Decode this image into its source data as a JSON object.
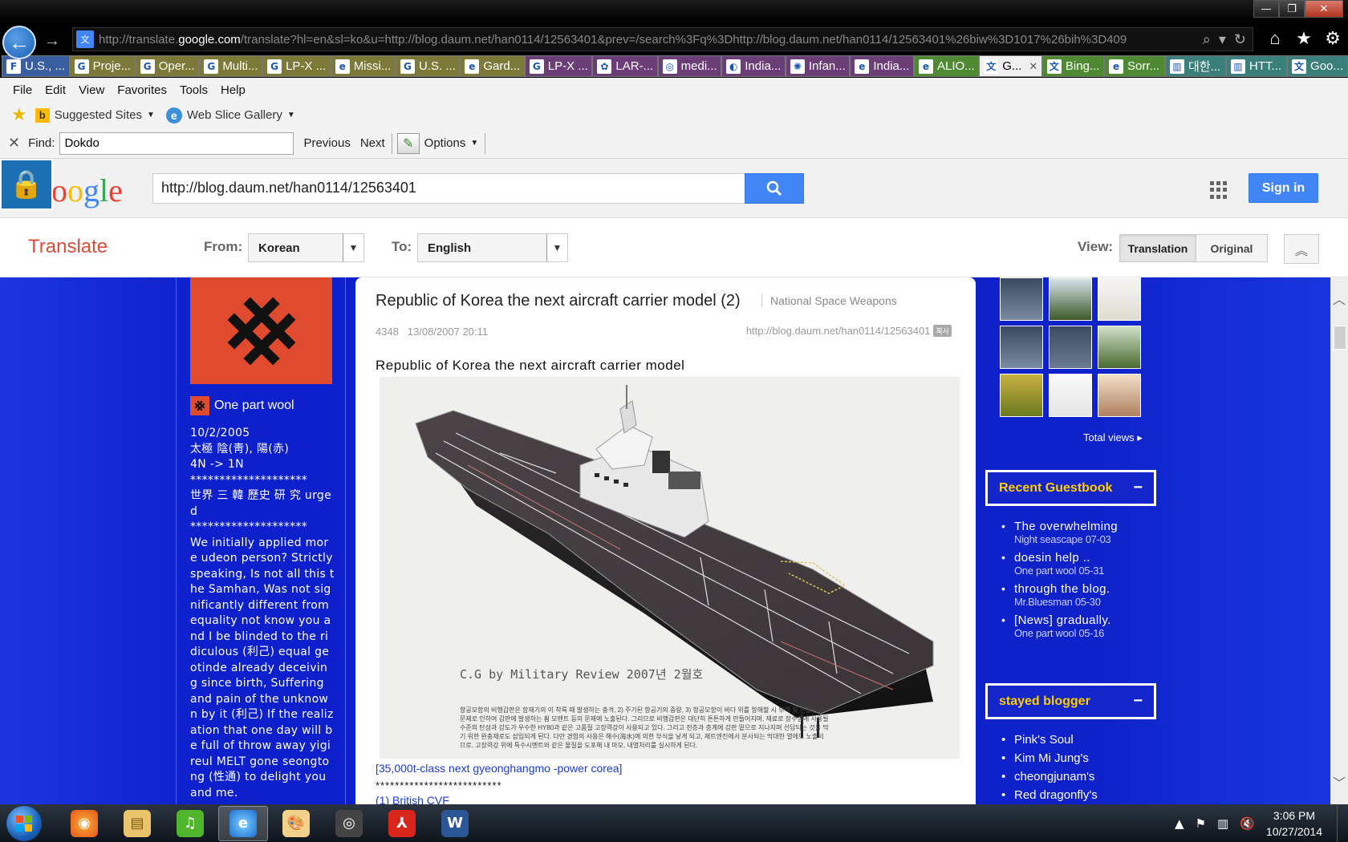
{
  "browser": {
    "url_prefix": "http://translate.",
    "url_host": "google.com",
    "url_rest": "/translate?hl=en&sl=ko&u=http://blog.daum.net/han0114/12563401&prev=/search%3Fq%3Dhttp://blog.daum.net/han0114/12563401%26biw%3D1017%26bih%3D409",
    "tabs": [
      {
        "label": "U.S., ...",
        "icon": "F",
        "color": "c-blue"
      },
      {
        "label": "Proje...",
        "icon": "G",
        "color": "c-olive"
      },
      {
        "label": "Oper...",
        "icon": "G",
        "color": "c-olive"
      },
      {
        "label": "Multi...",
        "icon": "G",
        "color": "c-olive"
      },
      {
        "label": "LP-X ...",
        "icon": "G",
        "color": "c-olive"
      },
      {
        "label": "Missi...",
        "icon": "e",
        "color": "c-olive"
      },
      {
        "label": "U.S. ...",
        "icon": "G",
        "color": "c-olive"
      },
      {
        "label": "Gard...",
        "icon": "e",
        "color": "c-olive"
      },
      {
        "label": "LP-X ...",
        "icon": "G",
        "color": "c-purple"
      },
      {
        "label": "LAR-...",
        "icon": "✿",
        "color": "c-purple"
      },
      {
        "label": "medi...",
        "icon": "◎",
        "color": "c-purple"
      },
      {
        "label": "India...",
        "icon": "◐",
        "color": "c-purple"
      },
      {
        "label": "Infan...",
        "icon": "✺",
        "color": "c-purple"
      },
      {
        "label": "India...",
        "icon": "e",
        "color": "c-purple"
      },
      {
        "label": "ALIO...",
        "icon": "e",
        "color": "c-green"
      },
      {
        "label": "G...",
        "icon": "文",
        "color": "active"
      },
      {
        "label": "Bing...",
        "icon": "文",
        "color": "c-green"
      },
      {
        "label": "Sorr...",
        "icon": "e",
        "color": "c-green"
      },
      {
        "label": "대한...",
        "icon": "▥",
        "color": "c-teal"
      },
      {
        "label": "HTT...",
        "icon": "▥",
        "color": "c-teal"
      },
      {
        "label": "Goo...",
        "icon": "文",
        "color": "c-teal"
      }
    ],
    "menu": [
      "File",
      "Edit",
      "View",
      "Favorites",
      "Tools",
      "Help"
    ],
    "favorites": {
      "suggested": "Suggested Sites",
      "webslice": "Web Slice Gallery"
    },
    "find": {
      "label": "Find:",
      "value": "Dokdo",
      "previous": "Previous",
      "next": "Next",
      "options": "Options"
    }
  },
  "google": {
    "logo_letters": [
      "o",
      "o",
      "g",
      "l",
      "e"
    ],
    "logo_colors": [
      "#ea4335",
      "#fbbc05",
      "#4285f4",
      "#34a853",
      "#ea4335"
    ],
    "search_value": "http://blog.daum.net/han0114/12563401",
    "sign_in": "Sign in"
  },
  "translate": {
    "title": "Translate",
    "from_label": "From:",
    "from_value": "Korean",
    "to_label": "To:",
    "to_value": "English",
    "view_label": "View:",
    "view_translation": "Translation",
    "view_original": "Original"
  },
  "blog": {
    "nickname": "One part wool",
    "profile_lines": [
      "10/2/2005",
      "太極 陰(靑), 陽(赤)",
      "4N -> 1N",
      "********************",
      "世界 三 韓 歷史 研 究 urged",
      "********************",
      "We initially applied more udeon person? Strictly speaking, Is not all this the Samhan, Was not significantly different from equality not know you and I be blinded to the ridiculous (利己) equal geotinde already deceiving since birth, Suffering and pain of the unknown by it (利己) If the realization that one day will be full of throw away yigireul MELT gone seongtong (性通) to delight you and me."
    ],
    "post": {
      "title": "Republic of Korea the next aircraft carrier model (2)",
      "category": "National Space Weapons",
      "views": "4348",
      "date": "13/08/2007 20:11",
      "url": "http://blog.daum.net/han0114/12563401",
      "copy_label": "복사",
      "subtitle": "Republic of Korea the next aircraft carrier model",
      "image_caption": "C.G by Military Review 2007년 2월호",
      "image_korean": "항공모함의 비행갑판은 함재기의 이 착륙 때 발생하는 충격, 2) 주기된 항공기의 중량, 3) 항공모함이 바다 위를 항해할 시 부력 및 흔들림의 문제로 인하여 감판에 발생하는 휨 모멘트 등의 문제에 노출된다. 그리므로 비행갑판은 대단히 튼튼하게 만들어지며, 재료로 장수함에 사용될 수준의 탄성과 강도가 우수한 HY80과 같은 고품질 고장력강이 사용되고 있다. 그리고 전층과 층계에 강판 밑으로 지나지며 선답되는 것을 막기 위한 완충재로도 삽입되게 된다. 다만 경험의 사용은 해수(海水)에 의한 부식을 낳게 되고, 제트엔진에서 분사되는 막대한 열에도 노출되므로, 고장력강 위에 특수시멘트와 같은 물질을 도포해 내 마모, 내열처리를 실시하게 된다.",
      "link": "[35,000t-class next gyeonghangmo -power corea]",
      "stars": "**************************",
      "section": "(1) British CVF"
    },
    "total_views": "Total views ▸",
    "guestbook": {
      "title": "Recent Guestbook",
      "items": [
        {
          "title": "The overwhelming",
          "sub": "Night seascape 07-03"
        },
        {
          "title": "doesin help ..",
          "sub": "One part wool 05-31"
        },
        {
          "title": "through the blog.",
          "sub": "Mr.Bluesman 05-30"
        },
        {
          "title": "[News] gradually.",
          "sub": "One part wool 05-16"
        }
      ]
    },
    "stayed": {
      "title": "stayed blogger",
      "items": [
        "Pink's Soul",
        "Kim Mi Jung's",
        "cheongjunam's",
        "Red dragonfly's"
      ]
    }
  },
  "taskbar": {
    "time": "3:06 PM",
    "date": "10/27/2014"
  }
}
